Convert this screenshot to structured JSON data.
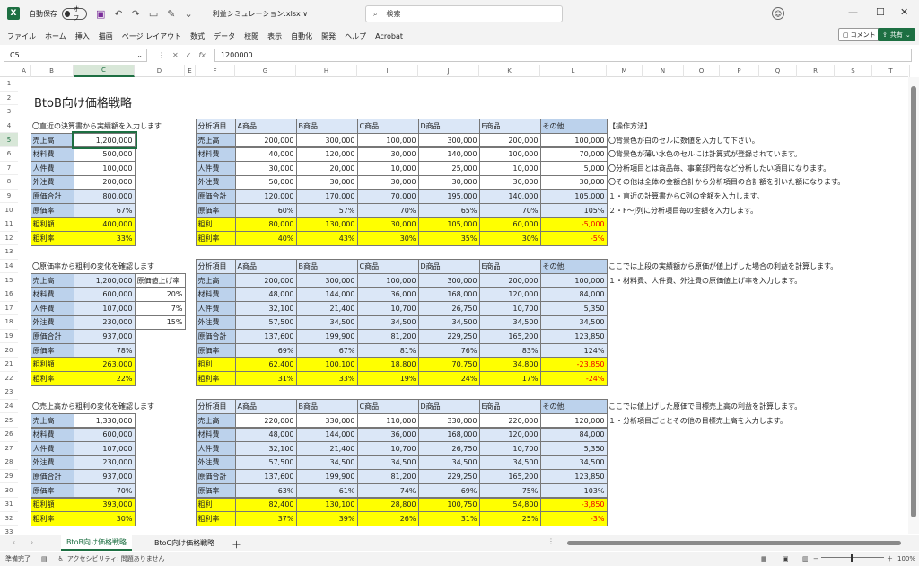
{
  "app": {
    "logo": "X",
    "autosave_label": "自動保存",
    "autosave_state": "オフ",
    "filename": "利益シミュレーション.xlsx ∨",
    "search_placeholder": "検索"
  },
  "menu": [
    "ファイル",
    "ホーム",
    "挿入",
    "描画",
    "ページ レイアウト",
    "数式",
    "データ",
    "校閲",
    "表示",
    "自動化",
    "開発",
    "ヘルプ",
    "Acrobat"
  ],
  "buttons": {
    "comment": "コメント",
    "share": "共有"
  },
  "formula": {
    "cell_ref": "C5",
    "fx": "fx",
    "value": "1200000"
  },
  "columns": [
    "A",
    "B",
    "C",
    "D",
    "E",
    "F",
    "G",
    "H",
    "I",
    "J",
    "K",
    "L",
    "M",
    "N",
    "O",
    "P",
    "Q",
    "R",
    "S",
    "T"
  ],
  "rows": [
    "1",
    "2",
    "3",
    "4",
    "5",
    "6",
    "7",
    "8",
    "9",
    "10",
    "11",
    "12",
    "13",
    "14",
    "15",
    "16",
    "17",
    "18",
    "19",
    "20",
    "21",
    "22",
    "23",
    "24",
    "25",
    "26",
    "27",
    "28",
    "29",
    "30",
    "31",
    "32",
    "33"
  ],
  "title": "BtoB向け価格戦略",
  "sections": {
    "s1": "〇直近の決算書から実績額を入力します",
    "s2": "〇原価率から粗利の変化を確認します",
    "s3": "〇売上高から粗利の変化を確認します"
  },
  "left1": [
    [
      "売上高",
      "1,200,000"
    ],
    [
      "材料費",
      "500,000"
    ],
    [
      "人件費",
      "100,000"
    ],
    [
      "外注費",
      "200,000"
    ],
    [
      "原価合計",
      "800,000"
    ],
    [
      "原価率",
      "67%"
    ],
    [
      "粗利額",
      "400,000"
    ],
    [
      "粗利率",
      "33%"
    ]
  ],
  "left2": [
    [
      "売上高",
      "1,200,000"
    ],
    [
      "材料費",
      "600,000"
    ],
    [
      "人件費",
      "107,000"
    ],
    [
      "外注費",
      "230,000"
    ],
    [
      "原価合計",
      "937,000"
    ],
    [
      "原価率",
      "78%"
    ],
    [
      "粗利額",
      "263,000"
    ],
    [
      "粗利率",
      "22%"
    ]
  ],
  "left2_side": {
    "header": "原価値上げ率",
    "vals": [
      "20%",
      "7%",
      "15%"
    ]
  },
  "left3": [
    [
      "売上高",
      "1,330,000"
    ],
    [
      "材料費",
      "600,000"
    ],
    [
      "人件費",
      "107,000"
    ],
    [
      "外注費",
      "230,000"
    ],
    [
      "原価合計",
      "937,000"
    ],
    [
      "原価率",
      "70%"
    ],
    [
      "粗利額",
      "393,000"
    ],
    [
      "粗利率",
      "30%"
    ]
  ],
  "right_headers": [
    "分析項目",
    "A商品",
    "B商品",
    "C商品",
    "D商品",
    "E商品",
    "その他"
  ],
  "right_labels": [
    "売上高",
    "材料費",
    "人件費",
    "外注費",
    "原価合計",
    "原価率",
    "粗利",
    "粗利率"
  ],
  "right1": [
    [
      "200,000",
      "300,000",
      "100,000",
      "300,000",
      "200,000",
      "100,000"
    ],
    [
      "40,000",
      "120,000",
      "30,000",
      "140,000",
      "100,000",
      "70,000"
    ],
    [
      "30,000",
      "20,000",
      "10,000",
      "25,000",
      "10,000",
      "5,000"
    ],
    [
      "50,000",
      "30,000",
      "30,000",
      "30,000",
      "30,000",
      "30,000"
    ],
    [
      "120,000",
      "170,000",
      "70,000",
      "195,000",
      "140,000",
      "105,000"
    ],
    [
      "60%",
      "57%",
      "70%",
      "65%",
      "70%",
      "105%"
    ],
    [
      "80,000",
      "130,000",
      "30,000",
      "105,000",
      "60,000",
      "-5,000"
    ],
    [
      "40%",
      "43%",
      "30%",
      "35%",
      "30%",
      "-5%"
    ]
  ],
  "right2": [
    [
      "200,000",
      "300,000",
      "100,000",
      "300,000",
      "200,000",
      "100,000"
    ],
    [
      "48,000",
      "144,000",
      "36,000",
      "168,000",
      "120,000",
      "84,000"
    ],
    [
      "32,100",
      "21,400",
      "10,700",
      "26,750",
      "10,700",
      "5,350"
    ],
    [
      "57,500",
      "34,500",
      "34,500",
      "34,500",
      "34,500",
      "34,500"
    ],
    [
      "137,600",
      "199,900",
      "81,200",
      "229,250",
      "165,200",
      "123,850"
    ],
    [
      "69%",
      "67%",
      "81%",
      "76%",
      "83%",
      "124%"
    ],
    [
      "62,400",
      "100,100",
      "18,800",
      "70,750",
      "34,800",
      "-23,850"
    ],
    [
      "31%",
      "33%",
      "19%",
      "24%",
      "17%",
      "-24%"
    ]
  ],
  "right3": [
    [
      "220,000",
      "330,000",
      "110,000",
      "330,000",
      "220,000",
      "120,000"
    ],
    [
      "48,000",
      "144,000",
      "36,000",
      "168,000",
      "120,000",
      "84,000"
    ],
    [
      "32,100",
      "21,400",
      "10,700",
      "26,750",
      "10,700",
      "5,350"
    ],
    [
      "57,500",
      "34,500",
      "34,500",
      "34,500",
      "34,500",
      "34,500"
    ],
    [
      "137,600",
      "199,900",
      "81,200",
      "229,250",
      "165,200",
      "123,850"
    ],
    [
      "63%",
      "61%",
      "74%",
      "69%",
      "75%",
      "103%"
    ],
    [
      "82,400",
      "130,100",
      "28,800",
      "100,750",
      "54,800",
      "-3,850"
    ],
    [
      "37%",
      "39%",
      "26%",
      "31%",
      "25%",
      "-3%"
    ]
  ],
  "notes1": [
    "【操作方法】",
    "〇背景色が白のセルに数値を入力して下さい。",
    "〇背景色が薄い水色のセルには計算式が登録されています。",
    "〇分析項目とは商品毎、事業部門毎など分析したい項目になります。",
    "〇その他は全体の金額合計から分析項目の合計額を引いた額になります。",
    "１・直近の計算書からC列の金額を入力します。",
    "２・F～J列に分析項目毎の金額を入力します。"
  ],
  "notes2": [
    "ここでは上段の実績額から原価が値上げした場合の利益を計算します。",
    "１・材料費、人件費、外注費の原価値上げ率を入力します。"
  ],
  "notes3": [
    "ここでは値上げした原価で目標売上高の利益を計算します。",
    "１・分析項目ごととその他の目標売上高を入力します。"
  ],
  "tabs": [
    "BtoB向け価格戦略",
    "BtoC向け価格戦略"
  ],
  "status": {
    "ready": "準備完了",
    "accessibility": "アクセシビリティ: 問題ありません",
    "zoom": "100%"
  }
}
